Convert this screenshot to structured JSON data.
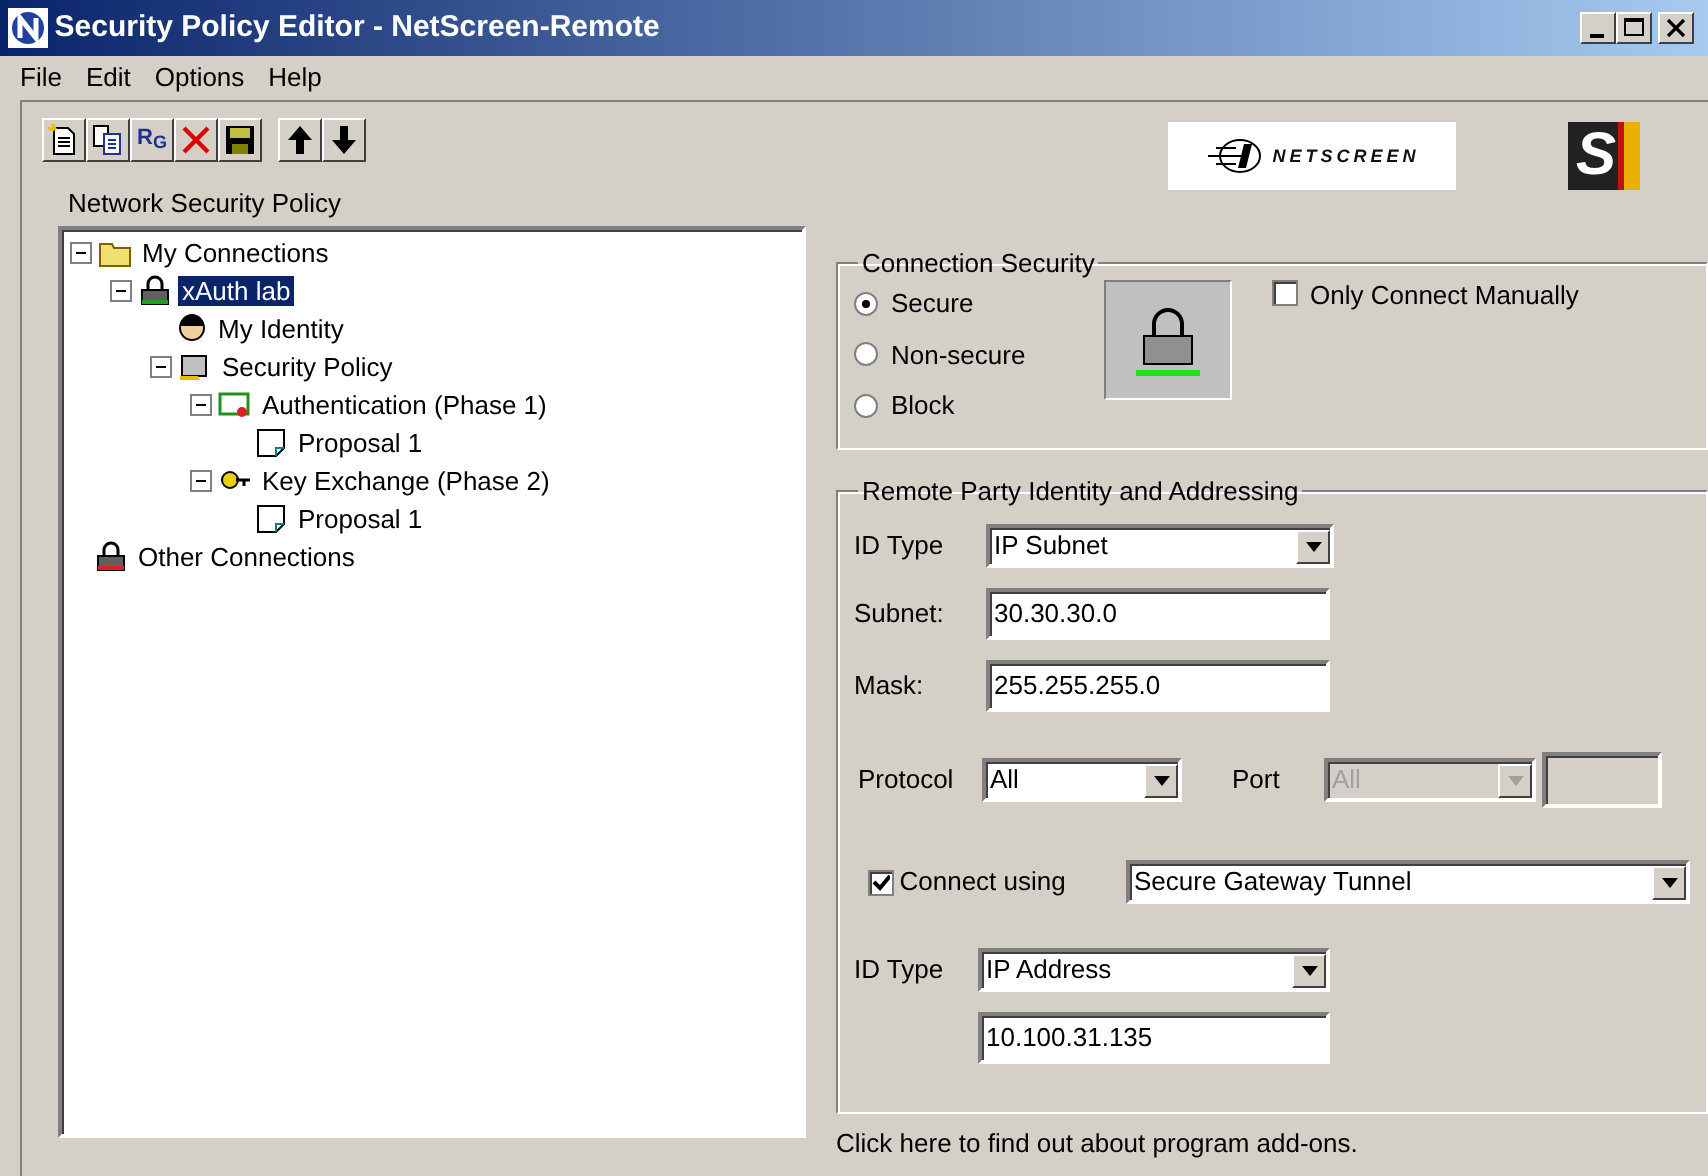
{
  "window": {
    "title": "Security Policy Editor - NetScreen-Remote"
  },
  "menu": [
    "File",
    "Edit",
    "Options",
    "Help"
  ],
  "toolbar": [
    {
      "kind": "new"
    },
    {
      "kind": "copy"
    },
    {
      "kind": "rg",
      "label": "R$_{G}$"
    },
    {
      "kind": "delete"
    },
    {
      "kind": "save"
    },
    {
      "kind": "up"
    },
    {
      "kind": "down"
    }
  ],
  "logos": {
    "brand": "NETSCREEN",
    "badge": "S"
  },
  "policy_tree": {
    "label": "Network Security Policy",
    "items": [
      {
        "label": "My Connections",
        "kind": "folder",
        "expanded": true,
        "selected": false,
        "children": [
          {
            "label": "xAuth lab",
            "kind": "lock",
            "expanded": true,
            "selected": true,
            "children": [
              {
                "label": "My Identity",
                "kind": "identity",
                "selected": false
              },
              {
                "label": "Security Policy",
                "kind": "policy",
                "expanded": true,
                "selected": false,
                "children": [
                  {
                    "label": "Authentication (Phase 1)",
                    "kind": "certificate",
                    "expanded": true,
                    "selected": false,
                    "children": [
                      {
                        "label": "Proposal 1",
                        "kind": "document",
                        "selected": false
                      }
                    ]
                  },
                  {
                    "label": "Key Exchange (Phase 2)",
                    "kind": "keys",
                    "expanded": true,
                    "selected": false,
                    "children": [
                      {
                        "label": "Proposal 1",
                        "kind": "document",
                        "selected": false
                      }
                    ]
                  }
                ]
              }
            ]
          }
        ]
      },
      {
        "label": "Other Connections",
        "kind": "lock-red",
        "selected": false
      }
    ]
  },
  "connection_security": {
    "title": "Connection Security",
    "options": [
      {
        "label": "Secure",
        "selected": true
      },
      {
        "label": "Non-secure",
        "selected": false
      },
      {
        "label": "Block",
        "selected": false
      }
    ],
    "only_connect_manually": {
      "label": "Only Connect Manually",
      "checked": false
    }
  },
  "remote_party": {
    "title": "Remote Party Identity and Addressing",
    "id_type": {
      "label": "ID Type",
      "value": "IP Subnet"
    },
    "subnet": {
      "label": "Subnet:",
      "value": "30.30.30.0"
    },
    "mask": {
      "label": "Mask:",
      "value": "255.255.255.0"
    },
    "protocol": {
      "label": "Protocol",
      "value": "All"
    },
    "port": {
      "label": "Port",
      "value": "All",
      "disabled": true
    },
    "connect_using": {
      "label": "Connect using",
      "checked": true,
      "value": "Secure Gateway Tunnel"
    },
    "gateway_id_type": {
      "label": "ID Type",
      "value": "IP Address"
    },
    "gateway_address": {
      "value": "10.100.31.135"
    }
  },
  "footer": "Click here to find out about program add-ons."
}
